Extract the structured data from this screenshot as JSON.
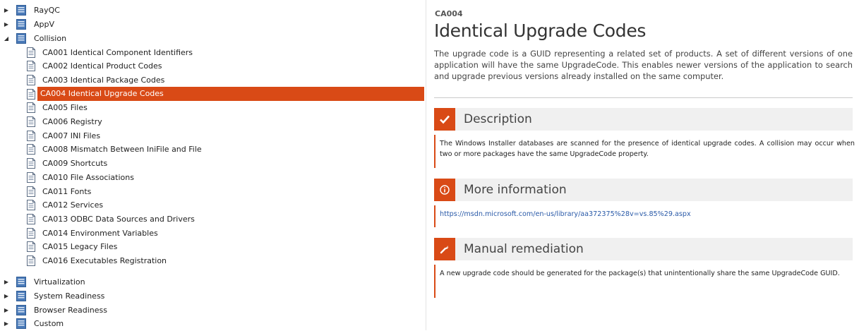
{
  "tree": {
    "groups_top": [
      {
        "label": "RayQC",
        "expanded": false
      },
      {
        "label": "AppV",
        "expanded": false
      },
      {
        "label": "Collision",
        "expanded": true
      }
    ],
    "collision_children": [
      "CA001 Identical Component Identifiers",
      "CA002 Identical Product Codes",
      "CA003 Identical Package Codes",
      "CA004 Identical Upgrade Codes",
      "CA005 Files",
      "CA006 Registry",
      "CA007 INI Files",
      "CA008 Mismatch Between IniFile and File",
      "CA009 Shortcuts",
      "CA010 File Associations",
      "CA011 Fonts",
      "CA012 Services",
      "CA013 ODBC Data Sources and Drivers",
      "CA014 Environment Variables",
      "CA015 Legacy Files",
      "CA016 Executables Registration"
    ],
    "selected_child": "CA004 Identical Upgrade Codes",
    "groups_bottom": [
      {
        "label": "Virtualization",
        "expanded": false
      },
      {
        "label": "System Readiness",
        "expanded": false
      },
      {
        "label": "Browser Readiness",
        "expanded": false
      },
      {
        "label": "Custom",
        "expanded": false
      }
    ]
  },
  "details": {
    "code": "CA004",
    "title": "Identical Upgrade Codes",
    "intro": "The upgrade code is a GUID representing a related set of products. A set of different versions of one application will have the same UpgradeCode. This enables newer versions of the application to search and upgrade previous versions already installed on the same computer.",
    "sections": {
      "description": {
        "heading": "Description",
        "icon": "checkmark-icon",
        "body": "The Windows Installer databases are scanned for the presence of identical upgrade codes. A collision may occur when two or more packages have the same UpgradeCode property."
      },
      "more_info": {
        "heading": "More information",
        "icon": "info-icon",
        "link": "https://msdn.microsoft.com/en-us/library/aa372375%28v=vs.85%29.aspx"
      },
      "remediation": {
        "heading": "Manual remediation",
        "icon": "wrench-icon",
        "body": "A new upgrade code should be generated for the package(s) that unintentionally share the same UpgradeCode GUID."
      }
    }
  },
  "colors": {
    "accent": "#d94a16",
    "group_icon_blue": "#4a7ab8",
    "section_bg": "#f0f0f0"
  }
}
